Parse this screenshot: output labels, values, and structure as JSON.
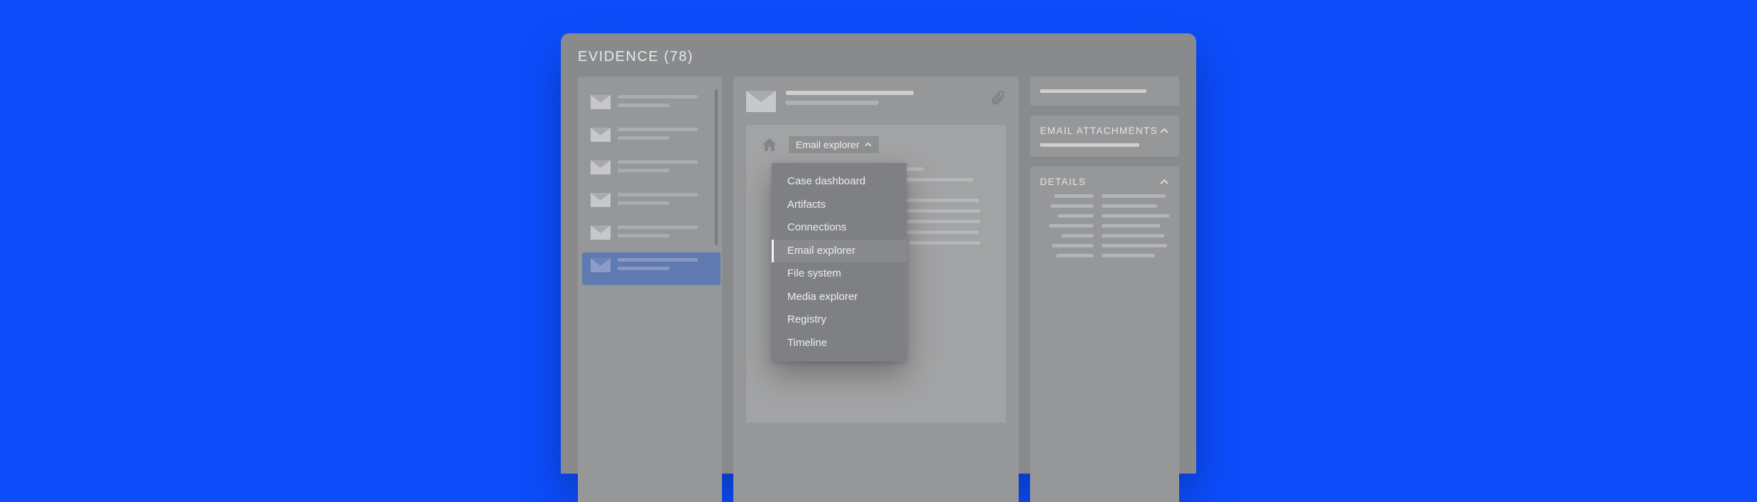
{
  "page_title": "EVIDENCE (78)",
  "sidebar": {
    "items": [
      {
        "selected": false
      },
      {
        "selected": false
      },
      {
        "selected": false
      },
      {
        "selected": false
      },
      {
        "selected": false
      },
      {
        "selected": true
      }
    ]
  },
  "explorer": {
    "pill_label": "Email explorer",
    "dropdown": [
      "Case dashboard",
      "Artifacts",
      "Connections",
      "Email explorer",
      "File system",
      "Media explorer",
      "Registry",
      "Timeline"
    ],
    "dropdown_active": "Email explorer"
  },
  "panels": {
    "attachments_title": "EMAIL ATTACHMENTS",
    "details_title": "DETAILS"
  }
}
